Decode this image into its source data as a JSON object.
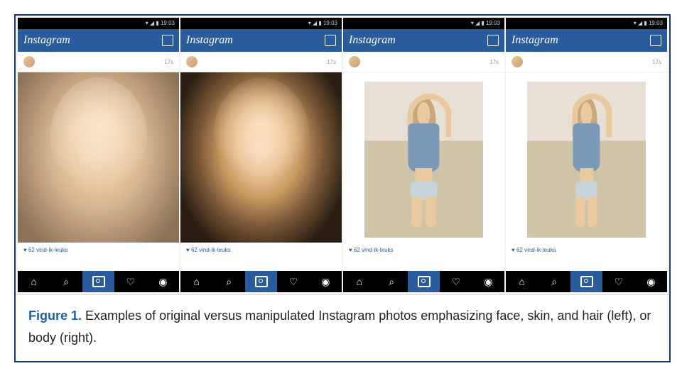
{
  "status_bar": {
    "time": "19:03",
    "indicators": "▾ ◢ ▮"
  },
  "app": {
    "title": "Instagram"
  },
  "post": {
    "timestamp": "17s",
    "likes_text": "62 vind-ik-leuks"
  },
  "nav": {
    "home": "⌂",
    "search": "⌕",
    "activity": "♡",
    "profile": "◉"
  },
  "caption": {
    "label": "Figure 1.",
    "text": "Examples of original versus manipulated Instagram photos emphasizing face, skin, and hair (left), or body (right)."
  },
  "panels": [
    {
      "kind": "selfie",
      "variant": "original"
    },
    {
      "kind": "selfie",
      "variant": "filtered"
    },
    {
      "kind": "body",
      "variant": "original"
    },
    {
      "kind": "body",
      "variant": "filtered"
    }
  ]
}
